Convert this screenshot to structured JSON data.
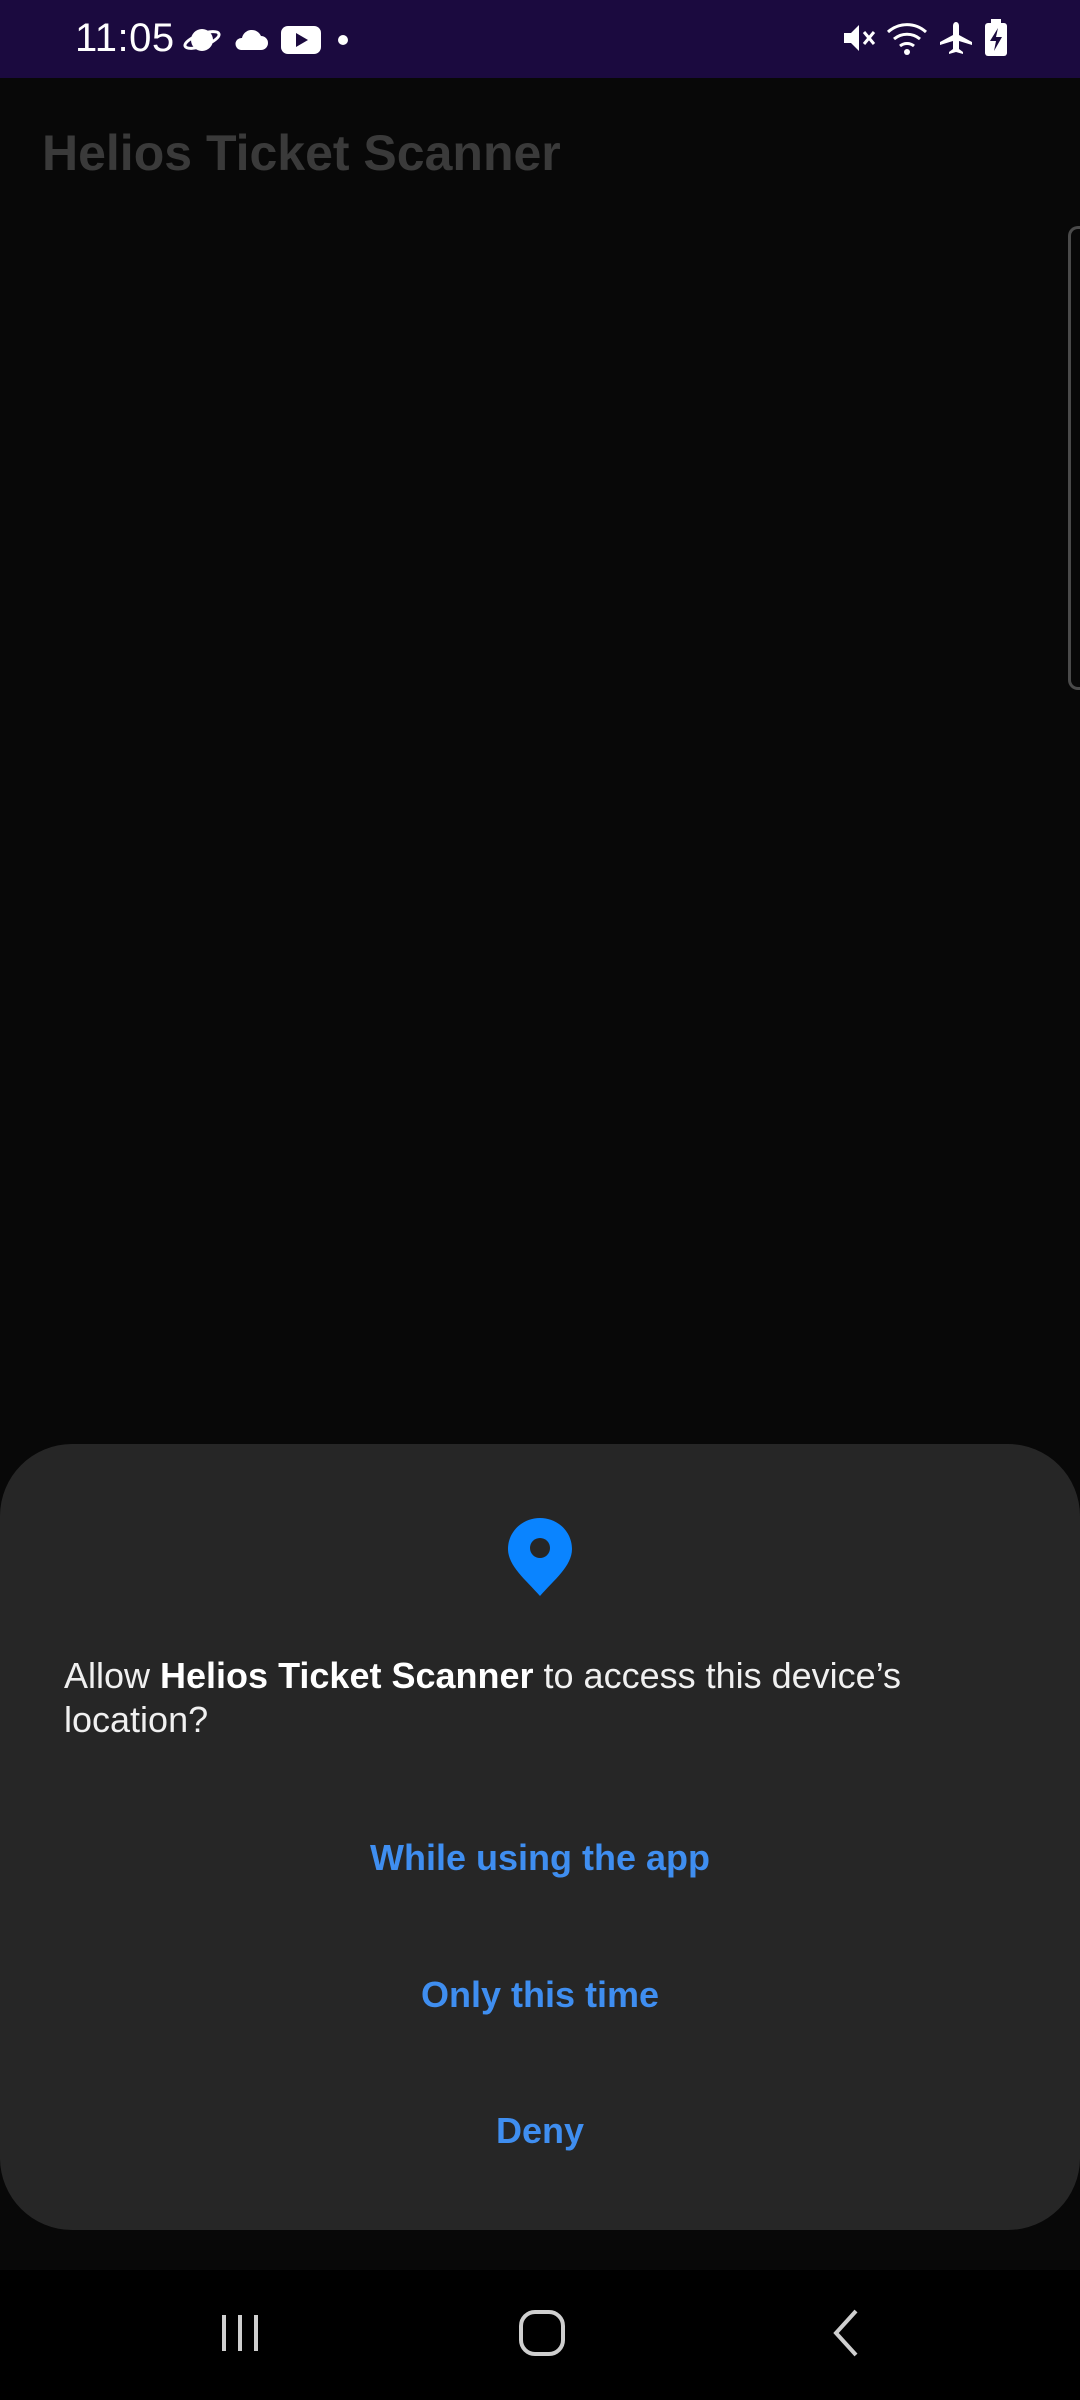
{
  "status_bar": {
    "time": "11:05",
    "left_icons": [
      "planet-icon",
      "cloud-icon",
      "youtube-icon",
      "dot-icon"
    ],
    "right_icons": [
      "mute-icon",
      "wifi-icon",
      "airplane-icon",
      "battery-charging-icon"
    ]
  },
  "app": {
    "title": "Helios Ticket Scanner"
  },
  "dialog": {
    "icon": "location-pin-icon",
    "message_prefix": "Allow ",
    "app_name": "Helios Ticket Scanner",
    "message_suffix": " to access this device’s location?",
    "buttons": {
      "while_using": "While using the app",
      "only_this_time": "Only this time",
      "deny": "Deny"
    },
    "accent_color": "#3f8ef0"
  },
  "nav_bar": {
    "buttons": [
      "recents-icon",
      "home-icon",
      "back-icon"
    ]
  }
}
